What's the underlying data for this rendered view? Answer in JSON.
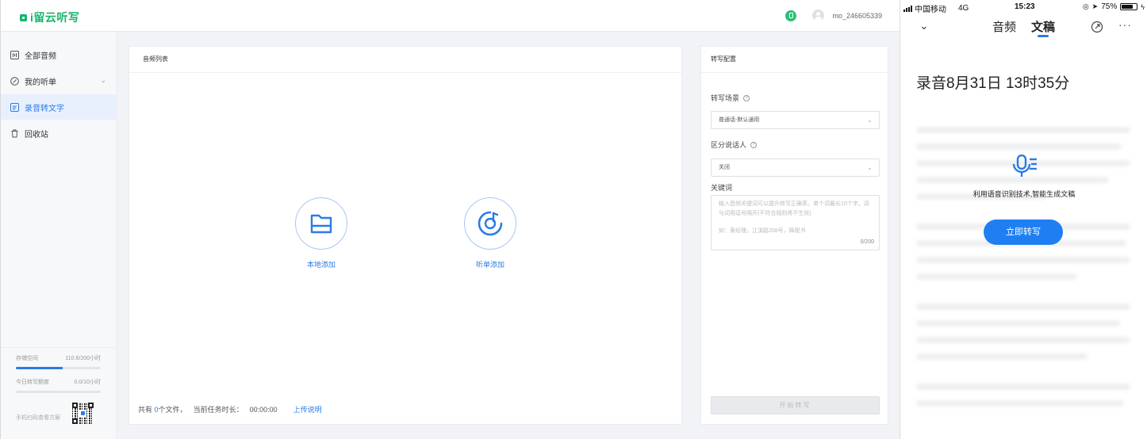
{
  "app": {
    "logo_text": "i留云听写",
    "username": "mo_246605339"
  },
  "sidebar": {
    "items": [
      {
        "label": "全部音频",
        "icon": "audio-file-icon"
      },
      {
        "label": "我的听单",
        "icon": "playlist-icon"
      },
      {
        "label": "录音转文字",
        "icon": "transcribe-icon",
        "active": true
      },
      {
        "label": "回收站",
        "icon": "trash-icon"
      }
    ],
    "storage_label": "存储空间",
    "storage_value": "110.6/200小时",
    "storage_fraction": 0.553,
    "daily_label": "今日转写额度",
    "daily_value": "0.0/10小时",
    "daily_fraction": 0.0,
    "manage_label": "手机扫码查看方案"
  },
  "audio_panel": {
    "title": "音频列表",
    "local_add_label": "本地添加",
    "playlist_add_label": "听单添加",
    "footer_prefix": "共有",
    "file_count": "0",
    "footer_files": "个文件，",
    "footer_duration_label": "当前任务时长：",
    "duration": "00:00:00",
    "upload_help": "上传说明"
  },
  "config_panel": {
    "title": "转写配置",
    "scene_label": "转写场景",
    "scene_value": "普通话-默认通用",
    "speaker_label": "区分说话人",
    "speaker_value": "关闭",
    "keywords_label": "关键词",
    "keywords_placeholder_1": "输入音频关键词可以提升转写正确率。单个词最长10个字。词与词用逗号隔开(不符合规则将不生效)",
    "keywords_placeholder_2": "如：黄经理，江滨路208号，降税书",
    "char_count": "0/200",
    "start_label": "开始转写"
  },
  "mobile": {
    "carrier": "中国移动",
    "network": "4G",
    "time": "15:23",
    "battery_text": "75%",
    "battery_fraction": 0.75,
    "tab_audio": "音频",
    "tab_doc": "文稿",
    "recording_title": "录音8月31日 13时35分",
    "promo_text": "利用语音识别技术,智能生成文稿",
    "transcribe_button": "立即转写"
  },
  "colors": {
    "brand_green": "#14b46c",
    "accent_blue": "#2b7be8",
    "mobile_button_blue": "#1f7ff2"
  }
}
